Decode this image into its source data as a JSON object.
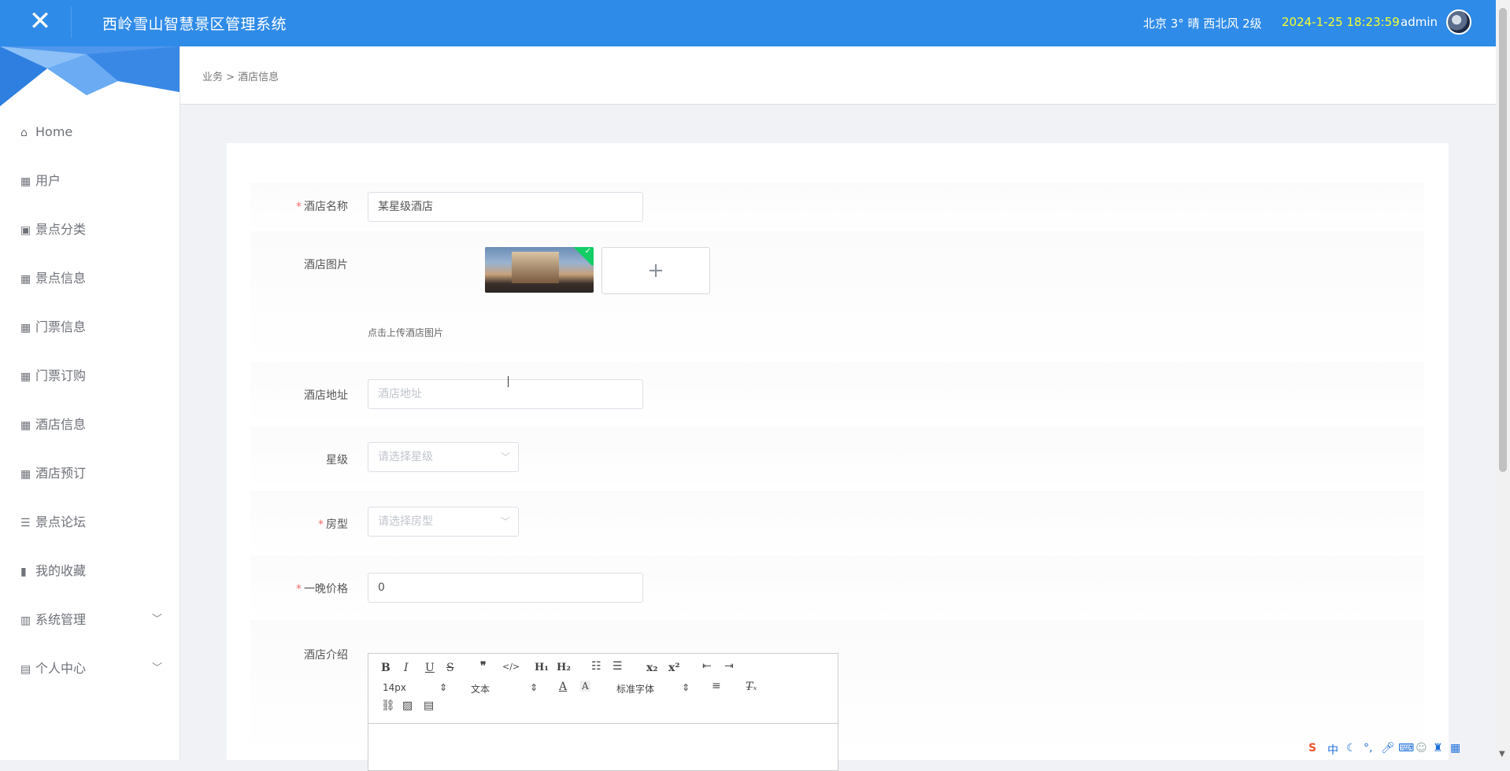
{
  "app": {
    "title": "西岭雪山智慧景区管理系统",
    "close_icon": "close-icon"
  },
  "header": {
    "weather": "北京  3°  晴  西北风  2级",
    "datetime": "2024-1-25 18:23:59",
    "username": "admin",
    "colors": {
      "bar": "#2f8be8",
      "datetime": "#f6ff2a"
    }
  },
  "sidebar": {
    "items": [
      {
        "label": "Home",
        "icon": "home-icon"
      },
      {
        "label": "用户",
        "icon": "grid-icon"
      },
      {
        "label": "景点分类",
        "icon": "clipboard-icon"
      },
      {
        "label": "景点信息",
        "icon": "grid-icon"
      },
      {
        "label": "门票信息",
        "icon": "grid-icon"
      },
      {
        "label": "门票订购",
        "icon": "grid-icon"
      },
      {
        "label": "酒店信息",
        "icon": "grid-icon"
      },
      {
        "label": "酒店预订",
        "icon": "grid-icon"
      },
      {
        "label": "景点论坛",
        "icon": "list-icon"
      },
      {
        "label": "我的收藏",
        "icon": "bar-chart-icon"
      },
      {
        "label": "系统管理",
        "icon": "library-icon",
        "expandable": true
      },
      {
        "label": "个人中心",
        "icon": "calendar-icon",
        "expandable": true
      }
    ]
  },
  "breadcrumb": "业务 > 酒店信息",
  "form": {
    "name": {
      "label": "酒店名称",
      "required": true,
      "value": "某星级酒店"
    },
    "image": {
      "label": "酒店图片",
      "required": false,
      "tip": "点击上传酒店图片",
      "add_symbol": "+"
    },
    "address": {
      "label": "酒店地址",
      "required": false,
      "placeholder": "酒店地址"
    },
    "star": {
      "label": "星级",
      "required": false,
      "placeholder": "请选择星级"
    },
    "room": {
      "label": "房型",
      "required": true,
      "placeholder": "请选择房型"
    },
    "price": {
      "label": "一晚价格",
      "required": true,
      "value": "0"
    },
    "intro": {
      "label": "酒店介绍",
      "required": false
    }
  },
  "editor": {
    "font_size": "14px",
    "header_select": "文本",
    "font_family": "标准字体"
  },
  "tray": {
    "ime": "中"
  }
}
